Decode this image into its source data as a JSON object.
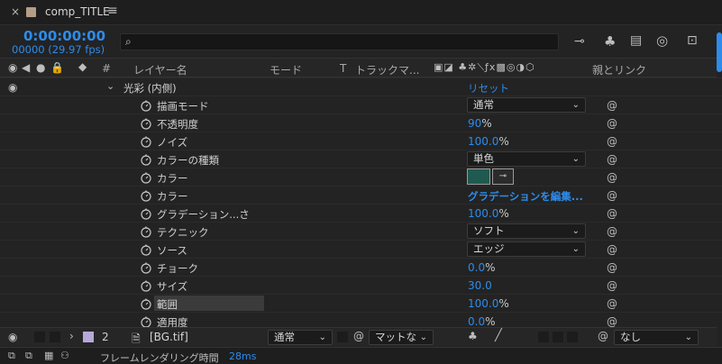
{
  "tab": {
    "title": "comp_TITLE"
  },
  "timecode": {
    "main": "0:00:00:00",
    "sub": "00000 (29.97 fps)"
  },
  "search": {
    "placeholder": ""
  },
  "columns": {
    "hash": "#",
    "layer_name": "レイヤー名",
    "mode": "モード",
    "t": "T",
    "track_matte": "トラックマ...",
    "parent_link": "親とリンク"
  },
  "effect": {
    "name": "光彩 (内側)",
    "reset": "リセット"
  },
  "properties": [
    {
      "label": "描画モード",
      "dropdown": "通常"
    },
    {
      "label": "不透明度",
      "value": "90",
      "unit": "%"
    },
    {
      "label": "ノイズ",
      "value": "100.0",
      "unit": "%"
    },
    {
      "label": "カラーの種類",
      "dropdown": "単色"
    },
    {
      "label": "カラー",
      "swatch": "#1f5a50"
    },
    {
      "label": "カラー",
      "value": "グラデーションを編集...",
      "unit": ""
    },
    {
      "label": "グラデーション...さ",
      "value": "100.0",
      "unit": "%"
    },
    {
      "label": "テクニック",
      "dropdown": "ソフト"
    },
    {
      "label": "ソース",
      "dropdown": "エッジ"
    },
    {
      "label": "チョーク",
      "value": "0.0",
      "unit": "%"
    },
    {
      "label": "サイズ",
      "value": "30.0",
      "unit": ""
    },
    {
      "label": "範囲",
      "value": "100.0",
      "unit": "%"
    },
    {
      "label": "適用度",
      "value": "0.0",
      "unit": "%"
    }
  ],
  "layer": {
    "number": "2",
    "name": "[BG.tif]",
    "mode": "通常",
    "matte": "マットな",
    "parent": "なし",
    "label_color": "#b6a8d8"
  },
  "status": {
    "label": "フレームレンダリング時間",
    "value": "28ms"
  },
  "colors": {
    "accent": "#2d8ceb",
    "bg": "#232323",
    "swatch": "#1f5a50"
  }
}
